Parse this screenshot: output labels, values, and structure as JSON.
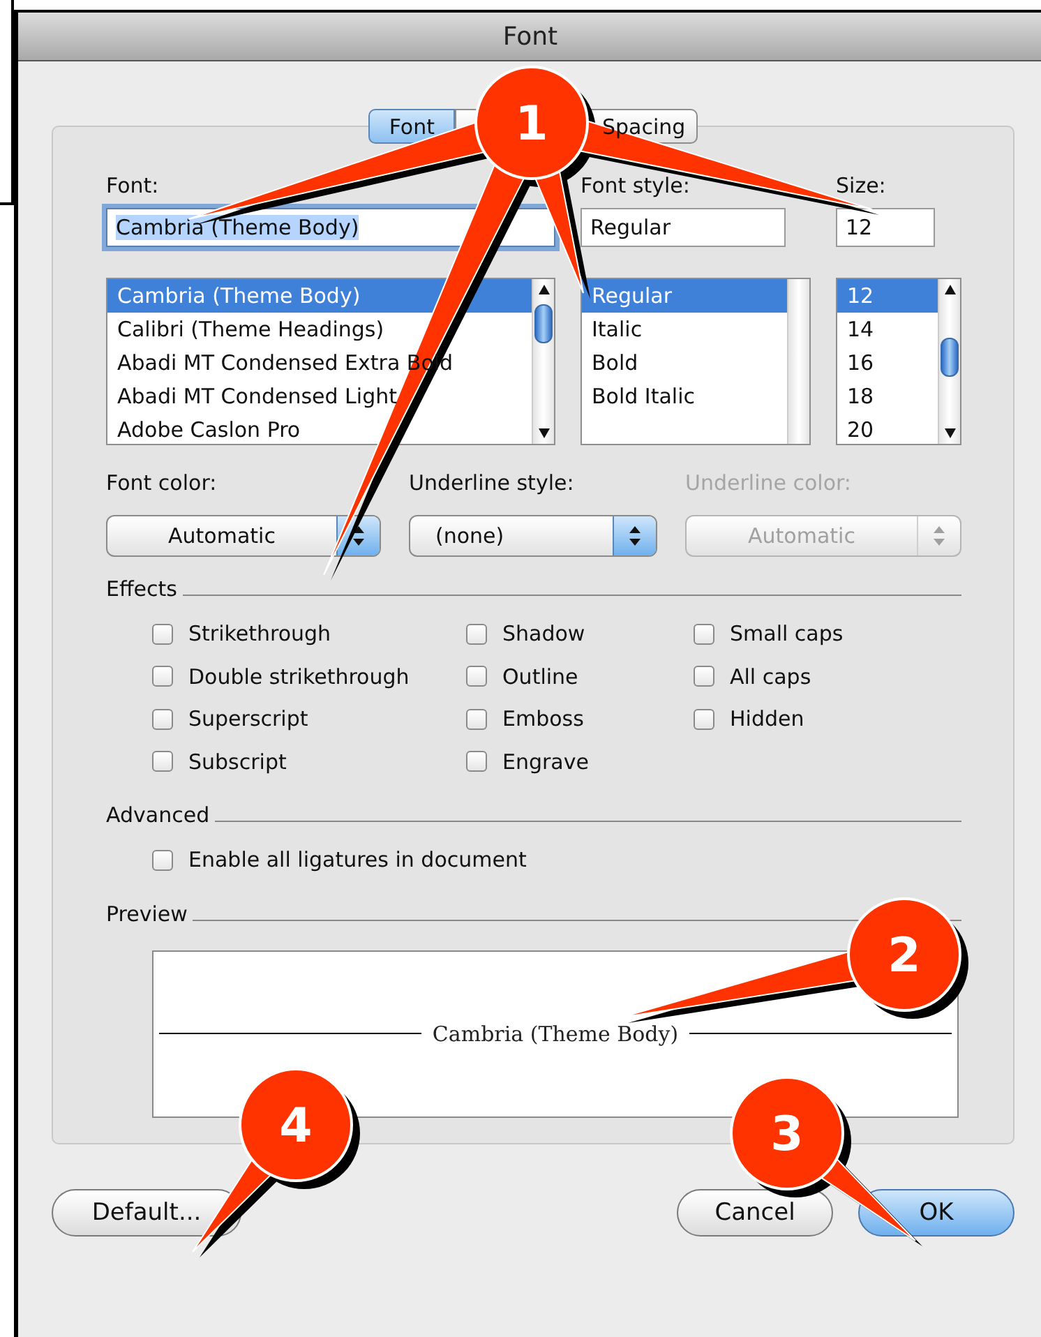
{
  "window": {
    "title": "Font"
  },
  "tabs": [
    {
      "label": "Font",
      "selected": true
    },
    {
      "label": "Spacing",
      "selected": false
    }
  ],
  "font": {
    "label": "Font:",
    "value": "Cambria (Theme Body)",
    "focused": true,
    "items": [
      {
        "label": "Cambria (Theme Body)",
        "selected": true
      },
      {
        "label": "Calibri (Theme Headings)",
        "selected": false
      },
      {
        "label": "Abadi MT Condensed Extra Bold",
        "selected": false
      },
      {
        "label": "Abadi MT Condensed Light",
        "selected": false
      },
      {
        "label": "Adobe Caslon Pro",
        "selected": false
      }
    ]
  },
  "font_style": {
    "label": "Font style:",
    "value": "Regular",
    "focused": false,
    "items": [
      {
        "label": "Regular",
        "selected": true
      },
      {
        "label": "Italic",
        "selected": false
      },
      {
        "label": "Bold",
        "selected": false
      },
      {
        "label": "Bold Italic",
        "selected": false
      }
    ]
  },
  "size": {
    "label": "Size:",
    "value": "12",
    "focused": false,
    "items": [
      {
        "label": "12",
        "selected": true
      },
      {
        "label": "14",
        "selected": false
      },
      {
        "label": "16",
        "selected": false
      },
      {
        "label": "18",
        "selected": false
      },
      {
        "label": "20",
        "selected": false
      }
    ]
  },
  "popups": [
    {
      "label": "Font color:",
      "value": "Automatic",
      "disabled": false
    },
    {
      "label": "Underline style:",
      "value": "(none)",
      "disabled": false
    },
    {
      "label": "Underline color:",
      "value": "Automatic",
      "disabled": true
    }
  ],
  "effects": {
    "title": "Effects",
    "columns": [
      [
        {
          "label": "Strikethrough",
          "checked": false
        },
        {
          "label": "Double strikethrough",
          "checked": false
        },
        {
          "label": "Superscript",
          "checked": false
        },
        {
          "label": "Subscript",
          "checked": false
        }
      ],
      [
        {
          "label": "Shadow",
          "checked": false
        },
        {
          "label": "Outline",
          "checked": false
        },
        {
          "label": "Emboss",
          "checked": false
        },
        {
          "label": "Engrave",
          "checked": false
        }
      ],
      [
        {
          "label": "Small caps",
          "checked": false
        },
        {
          "label": "All caps",
          "checked": false
        },
        {
          "label": "Hidden",
          "checked": false
        }
      ]
    ]
  },
  "advanced": {
    "title": "Advanced",
    "items": [
      {
        "label": "Enable all ligatures in document",
        "checked": false
      }
    ]
  },
  "preview": {
    "title": "Preview",
    "text": "Cambria (Theme Body)"
  },
  "buttons": [
    {
      "label": "Default...",
      "default": false
    },
    {
      "label": "Cancel",
      "default": false
    },
    {
      "label": "OK",
      "default": true
    }
  ],
  "callouts": [
    {
      "number": "1"
    },
    {
      "number": "2"
    },
    {
      "number": "3"
    },
    {
      "number": "4"
    }
  ]
}
